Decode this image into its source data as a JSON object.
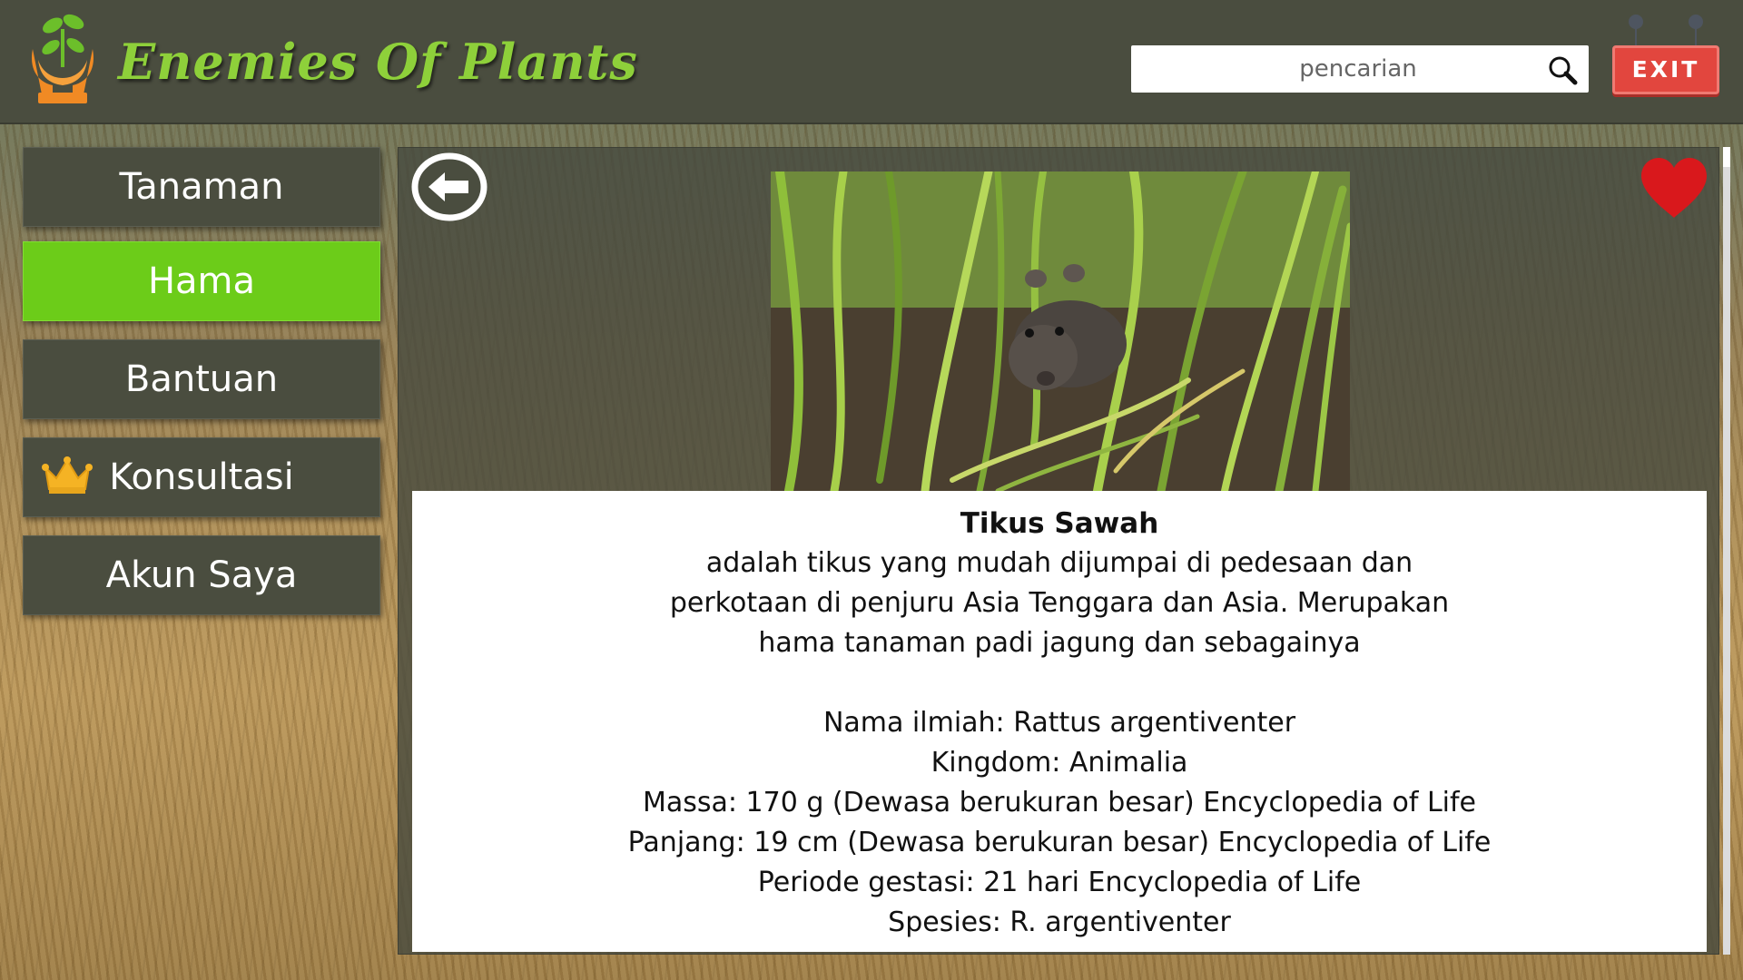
{
  "app": {
    "brand": "Enemies Of Plants",
    "search_placeholder": "pencarian",
    "exit_label": "EXIT"
  },
  "sidebar": {
    "items": [
      {
        "label": "Tanaman",
        "active": false
      },
      {
        "label": "Hama",
        "active": true
      },
      {
        "label": "Bantuan",
        "active": false
      },
      {
        "label": "Konsultasi",
        "active": false,
        "icon": "crown-icon"
      },
      {
        "label": "Akun Saya",
        "active": false
      }
    ]
  },
  "detail": {
    "title": "Tikus Sawah",
    "description": [
      "adalah tikus yang mudah dijumpai di pedesaan dan",
      "perkotaan di penjuru Asia Tenggara dan Asia. Merupakan",
      "hama tanaman padi jagung dan sebagainya"
    ],
    "facts": [
      "Nama ilmiah: Rattus argentiventer",
      "Kingdom: Animalia",
      "Massa: 170 g (Dewasa berukuran besar) Encyclopedia of Life",
      "Panjang: 19 cm (Dewasa berukuran besar) Encyclopedia of Life",
      "Periode gestasi: 21 hari Encyclopedia of Life",
      "Spesies: R. argentiventer"
    ]
  },
  "colors": {
    "header_bg": "#4a4d3f",
    "brand_green": "#8ed03a",
    "active_nav": "#6ccc19",
    "exit_red": "#e2463e",
    "favorite_heart": "#d9181c"
  },
  "icons": [
    "plant-hands-logo-icon",
    "search-icon",
    "exit-sign-icon",
    "crown-icon",
    "back-arrow-icon",
    "heart-icon"
  ]
}
